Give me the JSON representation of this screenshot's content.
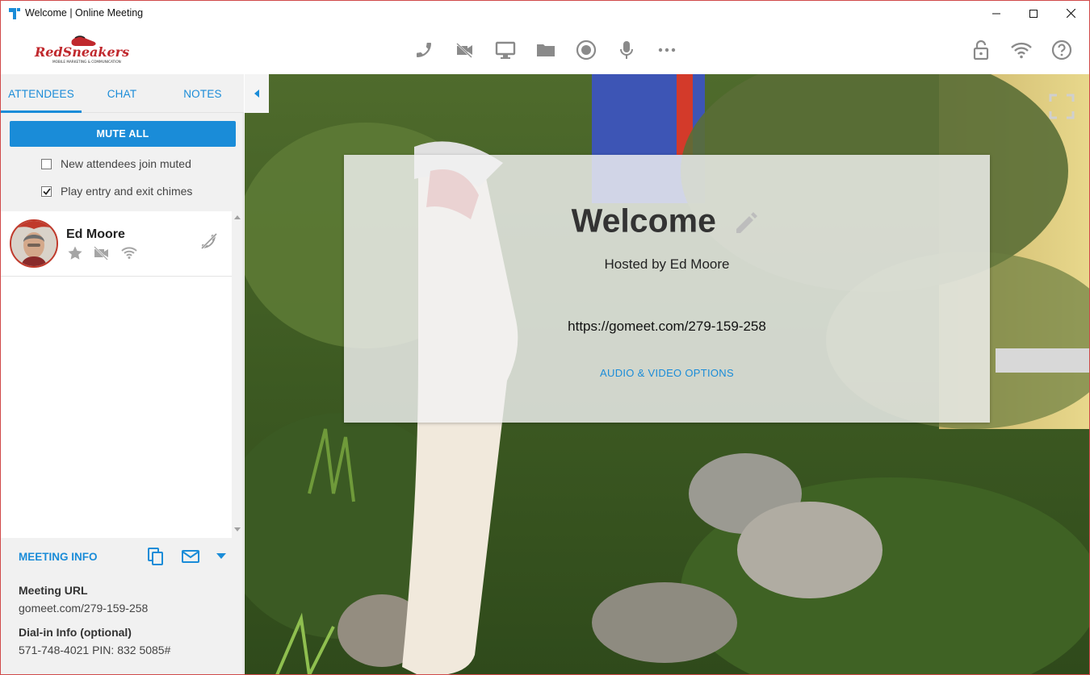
{
  "window": {
    "title": "Welcome | Online Meeting"
  },
  "logo": {
    "text": "RedSneakers",
    "tagline": "MOBILE MARKETING & COMMUNICATION"
  },
  "toolbar": {
    "left_icons": [
      "phone-icon",
      "video-off-icon",
      "screen-share-icon",
      "folder-icon",
      "record-icon",
      "microphone-icon",
      "more-icon"
    ],
    "right_icons": [
      "lock-icon",
      "wifi-icon",
      "help-icon"
    ]
  },
  "sidebar": {
    "tabs": [
      {
        "label": "ATTENDEES",
        "active": true
      },
      {
        "label": "CHAT",
        "active": false
      },
      {
        "label": "NOTES",
        "active": false
      }
    ],
    "mute_all_label": "MUTE ALL",
    "options": [
      {
        "label": "New attendees join muted",
        "checked": false
      },
      {
        "label": "Play entry and exit chimes",
        "checked": true
      }
    ],
    "attendees": [
      {
        "name": "Ed Moore",
        "icons": [
          "star-icon",
          "video-off-icon",
          "wifi-icon",
          "phone-off-icon"
        ]
      }
    ],
    "meeting_info": {
      "title": "MEETING INFO",
      "url_label": "Meeting URL",
      "url_value": "gomeet.com/279-159-258",
      "dialin_label": "Dial-in Info (optional)",
      "dialin_value": "571-748-4021 PIN: 832 5085#"
    }
  },
  "welcome": {
    "title": "Welcome",
    "hosted_by": "Hosted by Ed Moore",
    "url": "https://gomeet.com/279-159-258",
    "options_link": "AUDIO & VIDEO OPTIONS"
  },
  "colors": {
    "accent": "#1a8cd8",
    "window_border": "#d04a4a"
  }
}
